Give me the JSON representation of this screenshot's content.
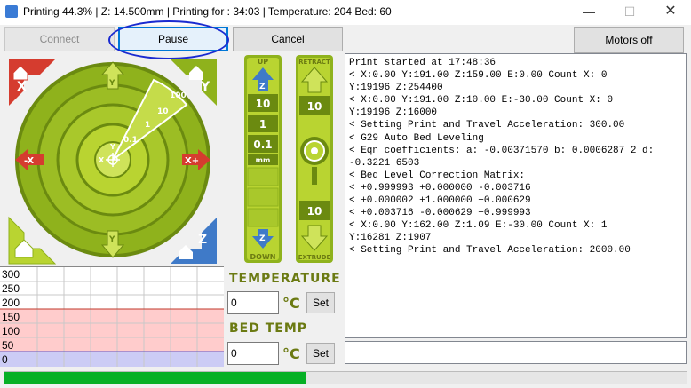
{
  "window": {
    "title": "Printing 44.3% | Z: 14.500mm | Printing for : 34:03  | Temperature: 204 Bed: 60",
    "min_glyph": "—",
    "max_glyph": "☐",
    "close_glyph": "✕"
  },
  "toolbar": {
    "connect_label": "Connect",
    "pause_label": "Pause",
    "cancel_label": "Cancel",
    "motors_off_label": "Motors off"
  },
  "jog": {
    "home_x_label": "X",
    "home_y_label": "Y",
    "home_z_label": "Z",
    "y_plus": "Y\n+",
    "y_minus": "Y\n-",
    "x_minus": "-X",
    "x_plus": "X+",
    "center_y": "Y",
    "center_x": "X",
    "steps": [
      "0.1",
      "1",
      "10",
      "100"
    ]
  },
  "z_controls": {
    "up_label": "UP",
    "down_label": "DOWN",
    "steps": [
      "10",
      "1",
      "0.1"
    ],
    "unit": "mm"
  },
  "e_controls": {
    "retract_label": "RETRACT",
    "extrude_label": "EXTRUDE",
    "top_value": "10",
    "bottom_value": "10"
  },
  "temperature": {
    "heading": "TEMPERATURE",
    "value": "0",
    "unit": "°C",
    "set_label": "Set"
  },
  "bed_temp": {
    "heading": "BED TEMP",
    "value": "0",
    "unit": "°C",
    "set_label": "Set"
  },
  "graph": {
    "y_labels": [
      "300",
      "250",
      "200",
      "150",
      "100",
      "50",
      "0"
    ]
  },
  "log": {
    "lines": [
      "Print started at 17:48:36",
      "< X:0.00 Y:191.00 Z:159.00 E:0.00 Count X: 0",
      "Y:19196 Z:254400",
      "< X:0.00 Y:191.00 Z:10.00 E:-30.00 Count X: 0",
      "Y:19196 Z:16000",
      "< Setting Print and Travel Acceleration: 300.00",
      "< G29 Auto Bed Leveling",
      "< Eqn coefficients: a: -0.00371570 b: 0.0006287 2 d:",
      "-0.3221 6503",
      "< Bed Level Correction Matrix:",
      "< +0.999993 +0.000000 -0.003716",
      "< +0.000002 +1.000000 +0.000629",
      "< +0.003716 -0.000629 +0.999993",
      "< X:0.00 Y:162.00 Z:1.09 E:-30.00 Count X: 1",
      "Y:16281 Z:1907",
      "< Setting Print and Travel Acceleration: 2000.00"
    ]
  },
  "command_input": {
    "value": ""
  },
  "progress": {
    "fraction": 0.443
  },
  "colors": {
    "olive_dark": "#6b8a10",
    "olive_mid": "#8fb21c",
    "olive_light": "#b9d431",
    "red_home": "#d53c2f",
    "blue_home": "#3f7ac8",
    "bed_band": "#ffcccc",
    "cold_band": "#ccccf5",
    "progress_green": "#06b025"
  }
}
